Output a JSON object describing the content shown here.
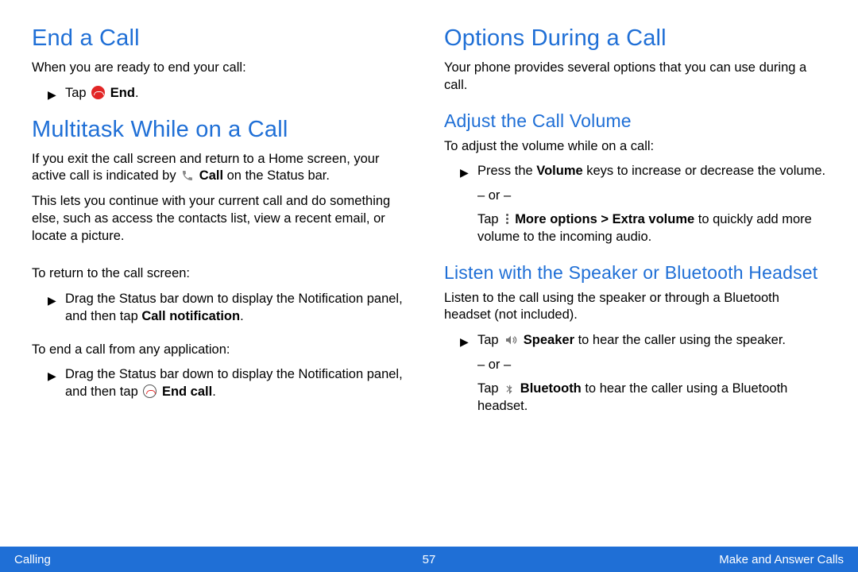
{
  "left": {
    "h1a": "End a Call",
    "p1": "When you are ready to end your call:",
    "step1_prefix": "Tap ",
    "step1_bold": "End",
    "h1b": "Multitask While on a Call",
    "p2a": "If you exit the call screen and return to a Home screen, your active call is indicated by ",
    "p2_bold": "Call",
    "p2b": " on the Status bar.",
    "p3": "This lets you continue with your current call and do something else, such as access the contacts list, view a recent email, or locate a picture.",
    "p4": "To return to the call screen:",
    "step2a": "Drag the Status bar down to display the Notification panel, and then tap ",
    "step2b": "Call notification",
    "p5": "To end a call from any application:",
    "step3a": "Drag the Status bar down to display the Notification panel, and then tap ",
    "step3b": "End call"
  },
  "right": {
    "h1": "Options During a Call",
    "p1": "Your phone provides several options that you can use during a call.",
    "h2a": "Adjust the Call Volume",
    "p2": "To adjust the volume while on a call:",
    "step1a": "Press the ",
    "step1b": "Volume",
    "step1c": " keys to increase or decrease the volume.",
    "or": "– or –",
    "step2a": "Tap ",
    "step2b": "More options > Extra volume",
    "step2c": " to quickly add more volume to the incoming audio.",
    "h2b": "Listen with the Speaker or Bluetooth Headset",
    "p3": "Listen to the call using the speaker or through a Bluetooth headset (not included).",
    "step3a": "Tap ",
    "step3b": "Speaker",
    "step3c": " to hear the caller using the speaker.",
    "step4a": "Tap ",
    "step4b": "Bluetooth",
    "step4c": " to hear the caller using a Bluetooth headset."
  },
  "footer": {
    "left": "Calling",
    "center": "57",
    "right": "Make and Answer Calls"
  }
}
